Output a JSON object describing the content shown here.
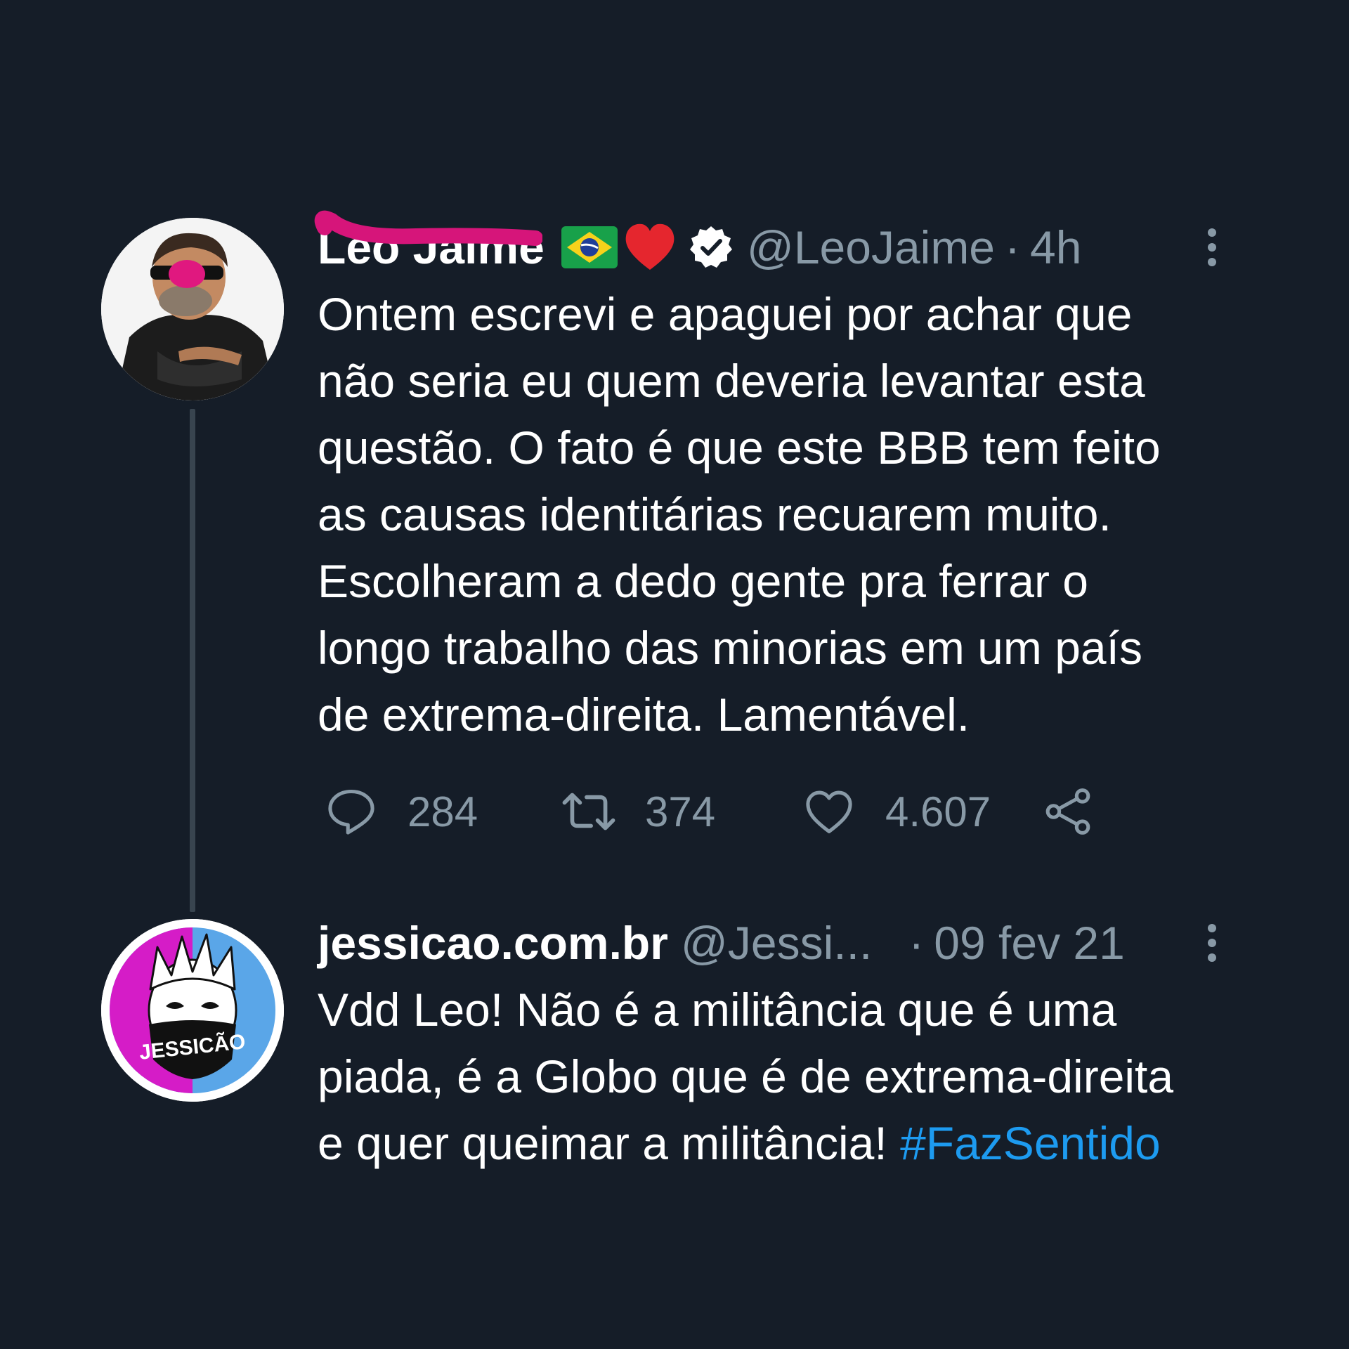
{
  "tweets": [
    {
      "display_name": "Leo Jaime",
      "handle": "@LeoJaime",
      "separator": "·",
      "time": "4h",
      "badges": [
        "brazil-flag-emoji",
        "red-heart-emoji",
        "verified-badge"
      ],
      "body_lines": [
        "Ontem escrevi e apaguei por achar que",
        "não seria eu quem deveria levantar esta",
        "questão. O fato é que este BBB tem feito",
        "as causas identitárias recuarem muito.",
        "Escolheram a dedo gente pra ferrar o",
        "longo trabalho das minorias em um país",
        "de extrema-direita.  Lamentável."
      ],
      "reply_count": "284",
      "retweet_count": "374",
      "like_count": "4.607"
    },
    {
      "display_name": "jessicao.com.br",
      "handle": "@Jessi...",
      "separator": "·",
      "time": "09 fev 21",
      "avatar_text": "JESSICÃO",
      "body_lines": [
        "Vdd Leo! Não é a militância que é uma",
        "piada, é a Globo que é de extrema-direita",
        "e quer queimar a militância!"
      ],
      "hashtag": "#FazSentido"
    }
  ],
  "colors": {
    "background": "#151d28",
    "text": "#ffffff",
    "muted": "#8899a6",
    "link": "#1d9bf0",
    "thread_line": "#38444f",
    "scribble": "#d6157a"
  },
  "icons": [
    "more-icon",
    "reply-icon",
    "retweet-icon",
    "like-icon",
    "share-icon"
  ]
}
